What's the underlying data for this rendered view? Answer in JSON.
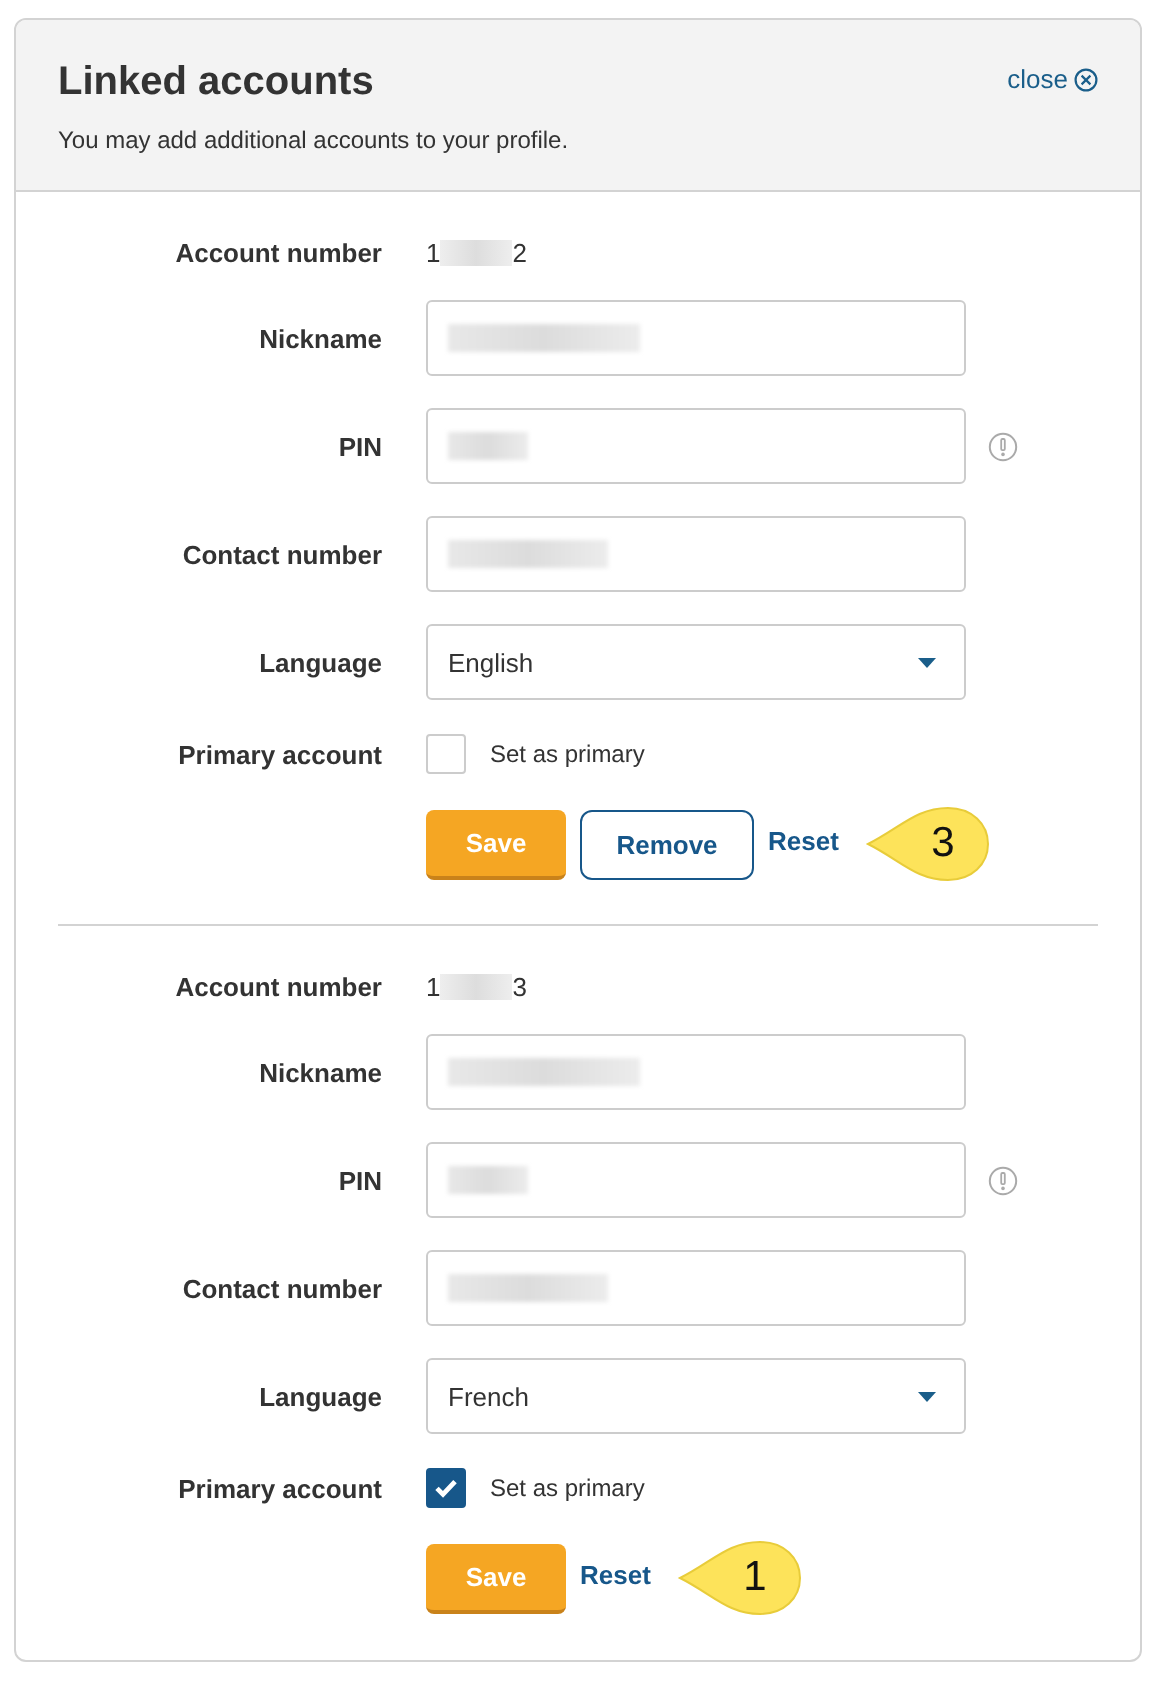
{
  "header": {
    "title": "Linked accounts",
    "subtitle": "You may add additional accounts to your profile.",
    "close": "close"
  },
  "accounts": [
    {
      "number_label": "Account number",
      "number_start": "1",
      "number_end": "2",
      "rows": [
        {
          "label": "Nickname",
          "kind": "text",
          "info": false
        },
        {
          "label": "PIN",
          "kind": "text",
          "info": true
        },
        {
          "label": "Contact number",
          "kind": "text",
          "info": false
        },
        {
          "label": "Language",
          "kind": "select",
          "value": "English",
          "info": false
        }
      ],
      "primary_label": "Primary account",
      "primary": {
        "label": "Set as primary",
        "checked": false
      },
      "buttons": [
        {
          "label": "Save",
          "kind": "primary"
        },
        {
          "label": "Remove",
          "kind": "outline"
        },
        {
          "label": "Reset",
          "kind": "link"
        }
      ],
      "callout": "3"
    },
    {
      "number_label": "Account number",
      "number_start": "1",
      "number_end": "3",
      "rows": [
        {
          "label": "Nickname",
          "kind": "text",
          "info": false
        },
        {
          "label": "PIN",
          "kind": "text",
          "info": true
        },
        {
          "label": "Contact number",
          "kind": "text",
          "info": false
        },
        {
          "label": "Language",
          "kind": "select",
          "value": "French",
          "info": false
        }
      ],
      "primary_label": "Primary account",
      "primary": {
        "label": "Set as primary",
        "checked": true
      },
      "buttons": [
        {
          "label": "Save",
          "kind": "primary"
        },
        {
          "label": "Reset",
          "kind": "link"
        }
      ],
      "callout": "1"
    }
  ]
}
